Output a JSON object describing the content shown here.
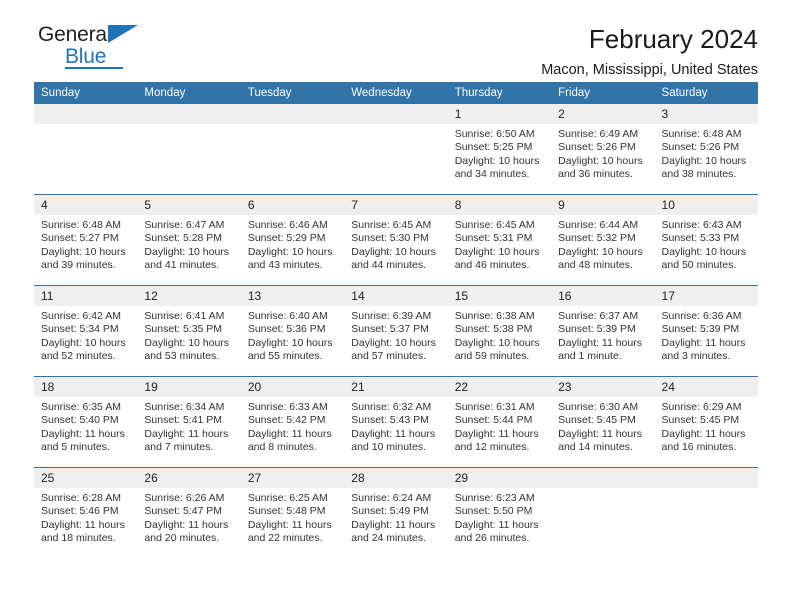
{
  "brand": {
    "name_top": "General",
    "name_bottom": "Blue",
    "accent_color": "#2272b8",
    "triangle_icon": "triangle-icon"
  },
  "header": {
    "title": "February 2024",
    "subtitle": "Macon, Mississippi, United States"
  },
  "theme": {
    "header_blue": "#3273a8",
    "daynum_gray": "#efefef",
    "text": "#333333"
  },
  "calendar": {
    "weekday_headers": [
      "Sunday",
      "Monday",
      "Tuesday",
      "Wednesday",
      "Thursday",
      "Friday",
      "Saturday"
    ],
    "weeks": [
      [
        {
          "day": "",
          "blank": true
        },
        {
          "day": "",
          "blank": true
        },
        {
          "day": "",
          "blank": true
        },
        {
          "day": "",
          "blank": true
        },
        {
          "day": "1",
          "sunrise": "Sunrise: 6:50 AM",
          "sunset": "Sunset: 5:25 PM",
          "daylight": "Daylight: 10 hours and 34 minutes."
        },
        {
          "day": "2",
          "sunrise": "Sunrise: 6:49 AM",
          "sunset": "Sunset: 5:26 PM",
          "daylight": "Daylight: 10 hours and 36 minutes."
        },
        {
          "day": "3",
          "sunrise": "Sunrise: 6:48 AM",
          "sunset": "Sunset: 5:26 PM",
          "daylight": "Daylight: 10 hours and 38 minutes."
        }
      ],
      [
        {
          "day": "4",
          "sunrise": "Sunrise: 6:48 AM",
          "sunset": "Sunset: 5:27 PM",
          "daylight": "Daylight: 10 hours and 39 minutes."
        },
        {
          "day": "5",
          "sunrise": "Sunrise: 6:47 AM",
          "sunset": "Sunset: 5:28 PM",
          "daylight": "Daylight: 10 hours and 41 minutes."
        },
        {
          "day": "6",
          "sunrise": "Sunrise: 6:46 AM",
          "sunset": "Sunset: 5:29 PM",
          "daylight": "Daylight: 10 hours and 43 minutes."
        },
        {
          "day": "7",
          "sunrise": "Sunrise: 6:45 AM",
          "sunset": "Sunset: 5:30 PM",
          "daylight": "Daylight: 10 hours and 44 minutes."
        },
        {
          "day": "8",
          "sunrise": "Sunrise: 6:45 AM",
          "sunset": "Sunset: 5:31 PM",
          "daylight": "Daylight: 10 hours and 46 minutes."
        },
        {
          "day": "9",
          "sunrise": "Sunrise: 6:44 AM",
          "sunset": "Sunset: 5:32 PM",
          "daylight": "Daylight: 10 hours and 48 minutes."
        },
        {
          "day": "10",
          "sunrise": "Sunrise: 6:43 AM",
          "sunset": "Sunset: 5:33 PM",
          "daylight": "Daylight: 10 hours and 50 minutes."
        }
      ],
      [
        {
          "day": "11",
          "sunrise": "Sunrise: 6:42 AM",
          "sunset": "Sunset: 5:34 PM",
          "daylight": "Daylight: 10 hours and 52 minutes."
        },
        {
          "day": "12",
          "sunrise": "Sunrise: 6:41 AM",
          "sunset": "Sunset: 5:35 PM",
          "daylight": "Daylight: 10 hours and 53 minutes."
        },
        {
          "day": "13",
          "sunrise": "Sunrise: 6:40 AM",
          "sunset": "Sunset: 5:36 PM",
          "daylight": "Daylight: 10 hours and 55 minutes."
        },
        {
          "day": "14",
          "sunrise": "Sunrise: 6:39 AM",
          "sunset": "Sunset: 5:37 PM",
          "daylight": "Daylight: 10 hours and 57 minutes."
        },
        {
          "day": "15",
          "sunrise": "Sunrise: 6:38 AM",
          "sunset": "Sunset: 5:38 PM",
          "daylight": "Daylight: 10 hours and 59 minutes."
        },
        {
          "day": "16",
          "sunrise": "Sunrise: 6:37 AM",
          "sunset": "Sunset: 5:39 PM",
          "daylight": "Daylight: 11 hours and 1 minute."
        },
        {
          "day": "17",
          "sunrise": "Sunrise: 6:36 AM",
          "sunset": "Sunset: 5:39 PM",
          "daylight": "Daylight: 11 hours and 3 minutes."
        }
      ],
      [
        {
          "day": "18",
          "sunrise": "Sunrise: 6:35 AM",
          "sunset": "Sunset: 5:40 PM",
          "daylight": "Daylight: 11 hours and 5 minutes."
        },
        {
          "day": "19",
          "sunrise": "Sunrise: 6:34 AM",
          "sunset": "Sunset: 5:41 PM",
          "daylight": "Daylight: 11 hours and 7 minutes."
        },
        {
          "day": "20",
          "sunrise": "Sunrise: 6:33 AM",
          "sunset": "Sunset: 5:42 PM",
          "daylight": "Daylight: 11 hours and 8 minutes."
        },
        {
          "day": "21",
          "sunrise": "Sunrise: 6:32 AM",
          "sunset": "Sunset: 5:43 PM",
          "daylight": "Daylight: 11 hours and 10 minutes."
        },
        {
          "day": "22",
          "sunrise": "Sunrise: 6:31 AM",
          "sunset": "Sunset: 5:44 PM",
          "daylight": "Daylight: 11 hours and 12 minutes."
        },
        {
          "day": "23",
          "sunrise": "Sunrise: 6:30 AM",
          "sunset": "Sunset: 5:45 PM",
          "daylight": "Daylight: 11 hours and 14 minutes."
        },
        {
          "day": "24",
          "sunrise": "Sunrise: 6:29 AM",
          "sunset": "Sunset: 5:45 PM",
          "daylight": "Daylight: 11 hours and 16 minutes."
        }
      ],
      [
        {
          "day": "25",
          "sunrise": "Sunrise: 6:28 AM",
          "sunset": "Sunset: 5:46 PM",
          "daylight": "Daylight: 11 hours and 18 minutes."
        },
        {
          "day": "26",
          "sunrise": "Sunrise: 6:26 AM",
          "sunset": "Sunset: 5:47 PM",
          "daylight": "Daylight: 11 hours and 20 minutes."
        },
        {
          "day": "27",
          "sunrise": "Sunrise: 6:25 AM",
          "sunset": "Sunset: 5:48 PM",
          "daylight": "Daylight: 11 hours and 22 minutes."
        },
        {
          "day": "28",
          "sunrise": "Sunrise: 6:24 AM",
          "sunset": "Sunset: 5:49 PM",
          "daylight": "Daylight: 11 hours and 24 minutes."
        },
        {
          "day": "29",
          "sunrise": "Sunrise: 6:23 AM",
          "sunset": "Sunset: 5:50 PM",
          "daylight": "Daylight: 11 hours and 26 minutes."
        },
        {
          "day": "",
          "blank": true
        },
        {
          "day": "",
          "blank": true
        }
      ]
    ]
  }
}
